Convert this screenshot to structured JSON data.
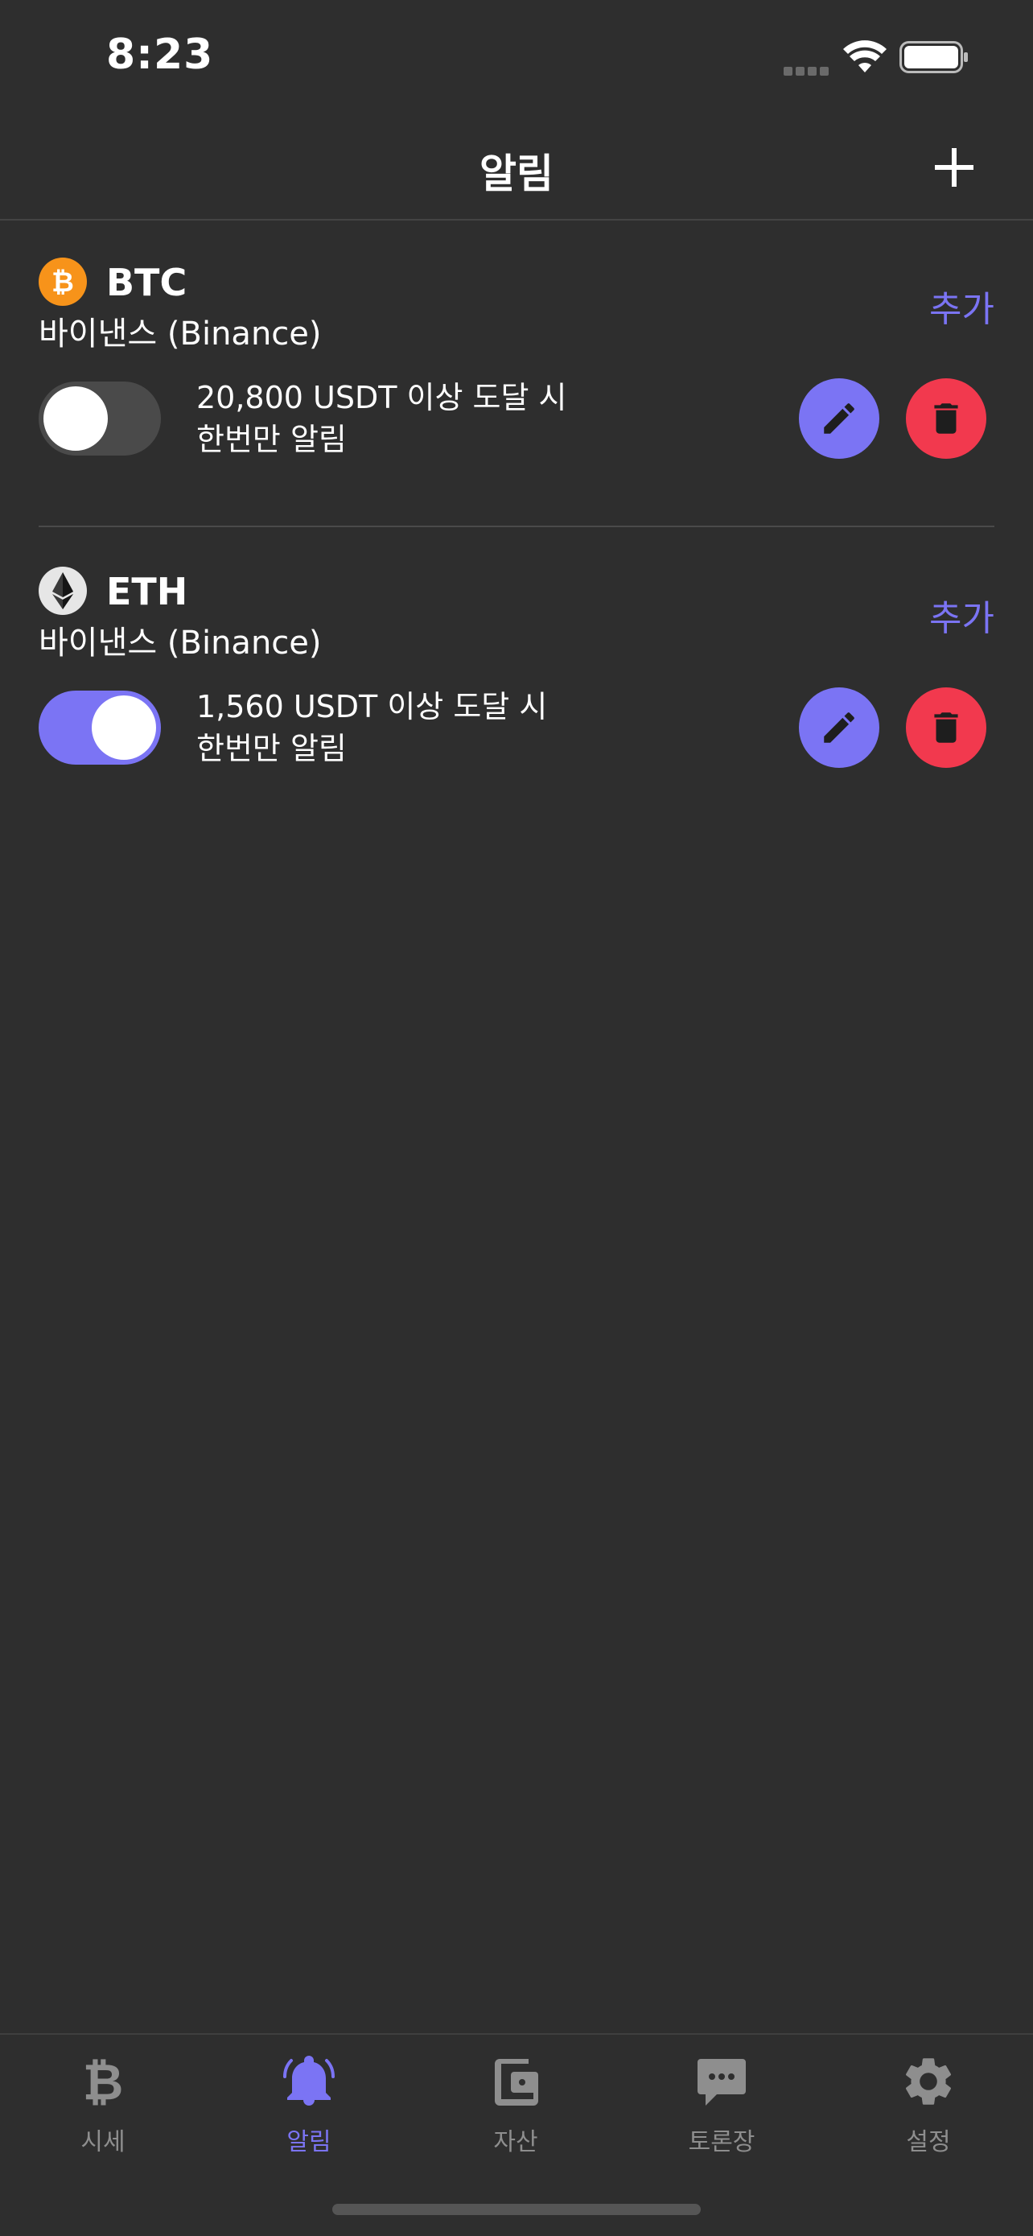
{
  "status_bar": {
    "time": "8:23"
  },
  "header": {
    "title": "알림"
  },
  "alerts": [
    {
      "symbol": "BTC",
      "exchange": "바이낸스 (Binance)",
      "add_label": "추가",
      "condition": "20,800 USDT 이상 도달 시",
      "frequency": "한번만 알림",
      "enabled": false,
      "icon": "bitcoin-icon",
      "icon_color": "#f7931a"
    },
    {
      "symbol": "ETH",
      "exchange": "바이낸스 (Binance)",
      "add_label": "추가",
      "condition": "1,560 USDT 이상 도달 시",
      "frequency": "한번만 알림",
      "enabled": true,
      "icon": "ethereum-icon",
      "icon_color": "#e6e6e6"
    }
  ],
  "tabs": [
    {
      "label": "시세",
      "icon": "bitcoin-icon",
      "active": false
    },
    {
      "label": "알림",
      "icon": "bell-icon",
      "active": true
    },
    {
      "label": "자산",
      "icon": "wallet-icon",
      "active": false
    },
    {
      "label": "토론장",
      "icon": "chat-icon",
      "active": false
    },
    {
      "label": "설정",
      "icon": "gear-icon",
      "active": false
    }
  ],
  "colors": {
    "background": "#2e2e2e",
    "accent": "#7b74f4",
    "danger": "#f2394e",
    "inactive_tab": "#8e8e8e"
  }
}
